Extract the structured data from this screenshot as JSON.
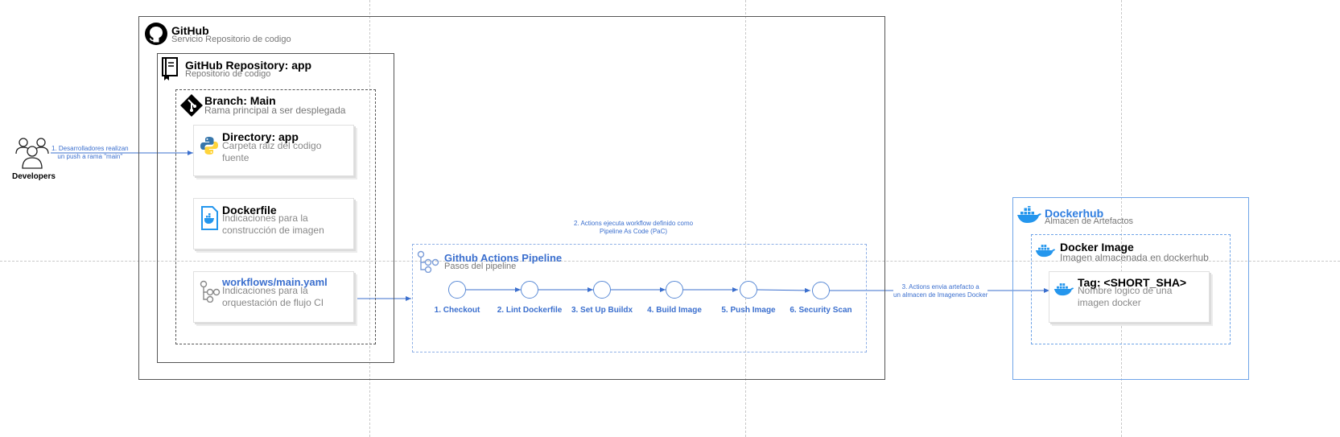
{
  "developers": {
    "label": "Developers",
    "note_line1": "1. Desarrolladores realizan",
    "note_line2": "un push a rama \"main\""
  },
  "github": {
    "title": "GitHub",
    "subtitle": "Servicio Repositorio de codigo"
  },
  "repository": {
    "title": "GitHub Repository: app",
    "subtitle": "Repositorio de codigo"
  },
  "branch": {
    "title": "Branch: Main",
    "subtitle": "Rama principal a ser desplegada"
  },
  "directory": {
    "title": "Directory: app",
    "desc_line1": "Carpeta raiz del codigo",
    "desc_line2": "fuente"
  },
  "dockerfile": {
    "title": "Dockerfile",
    "desc_line1": "Indicaciones para la",
    "desc_line2": "construcción de imagen"
  },
  "workflow": {
    "title": "workflows/main.yaml",
    "desc_line1": "Indicaciones para la",
    "desc_line2": "orquestación de flujo CI"
  },
  "pipeline": {
    "note_line1": "2. Actions ejecuta workflow definido como",
    "note_line2": "Pipeline As Code (PaC)",
    "title": "Github Actions Pipeline",
    "subtitle": "Pasos del pipeline",
    "steps": [
      "1. Checkout",
      "2. Lint Dockerfile",
      "3. Set Up Buildx",
      "4. Build Image",
      "5. Push Image",
      "6. Security Scan"
    ]
  },
  "artifact_note": {
    "line1": "3. Actions envia artefacto a",
    "line2": "un almacen de Imagenes Docker"
  },
  "dockerhub": {
    "title": "Dockerhub",
    "subtitle": "Almacen de Artefactos"
  },
  "docker_image": {
    "title": "Docker Image",
    "subtitle": "Imagen almacenada en dockerhub"
  },
  "tag": {
    "title": "Tag: <SHORT_SHA>",
    "desc_line1": "Nombre logico de una",
    "desc_line2": "imagen docker"
  },
  "colors": {
    "accent_blue": "#3b6fce",
    "docker_blue": "#2496ed",
    "python_blue": "#3776ab",
    "python_yellow": "#ffd43b"
  }
}
